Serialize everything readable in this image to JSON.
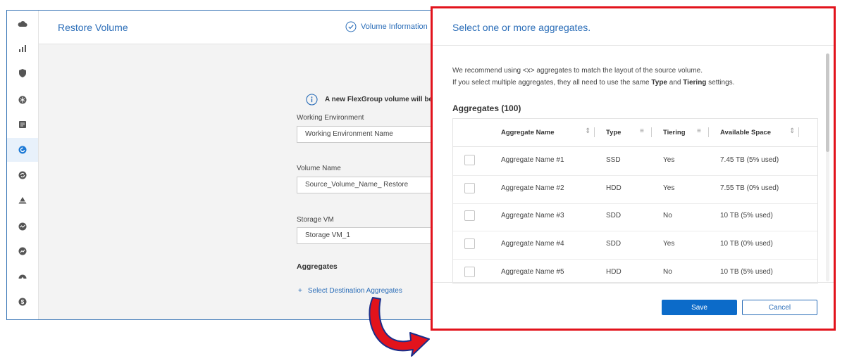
{
  "app": {
    "title": "Restore Volume",
    "step_label": "Volume Information",
    "info_text": "A new FlexGroup volume will be",
    "fields": {
      "working_env_label": "Working Environment",
      "working_env_value": "Working Environment Name",
      "volume_name_label": "Volume Name",
      "volume_name_value": "Source_Volume_Name_ Restore",
      "storage_vm_label": "Storage VM",
      "storage_vm_value": "Storage VM_1"
    },
    "aggregates_label": "Aggregates",
    "select_link_plus": "+",
    "select_link": "Select Destination Aggregates"
  },
  "sidebar": {
    "icons": [
      "cloud-icon",
      "chart-bars-icon",
      "shield-icon",
      "snowflake-icon",
      "document-icon",
      "restore-icon",
      "sync-icon",
      "tiering-icon",
      "monitoring-icon",
      "analytics-icon",
      "dashboard-gauge-icon",
      "dollar-icon"
    ],
    "active": "restore-icon"
  },
  "modal": {
    "title": "Select one or more aggregates.",
    "desc_line1": "We recommend using <x> aggregates to match the layout of the source volume.",
    "desc_line2_prefix": "If you select multiple aggregates, they all need to use the same ",
    "desc_line2_type": "Type",
    "desc_line2_and": " and ",
    "desc_line2_tiering": "Tiering",
    "desc_line2_suffix": " settings.",
    "table_title": "Aggregates (100)",
    "columns": {
      "name": "Aggregate Name",
      "type": "Type",
      "tiering": "Tiering",
      "space": "Available Space"
    },
    "rows": [
      {
        "name": "Aggregate Name  #1",
        "type": "SSD",
        "tiering": "Yes",
        "space": "7.45 TB (5% used)"
      },
      {
        "name": "Aggregate Name  #2",
        "type": "HDD",
        "tiering": "Yes",
        "space": "7.55 TB (0% used)"
      },
      {
        "name": "Aggregate Name  #3",
        "type": "SDD",
        "tiering": "No",
        "space": "10 TB (5% used)"
      },
      {
        "name": "Aggregate Name  #4",
        "type": "SDD",
        "tiering": "Yes",
        "space": "10 TB (0% used)"
      },
      {
        "name": "Aggregate Name  #5",
        "type": "HDD",
        "tiering": "No",
        "space": "10 TB (5% used)"
      }
    ],
    "save_label": "Save",
    "cancel_label": "Cancel"
  },
  "colors": {
    "accent": "#2a6db8",
    "primary_button": "#0c6bc9",
    "highlight_border": "#e2131c"
  }
}
